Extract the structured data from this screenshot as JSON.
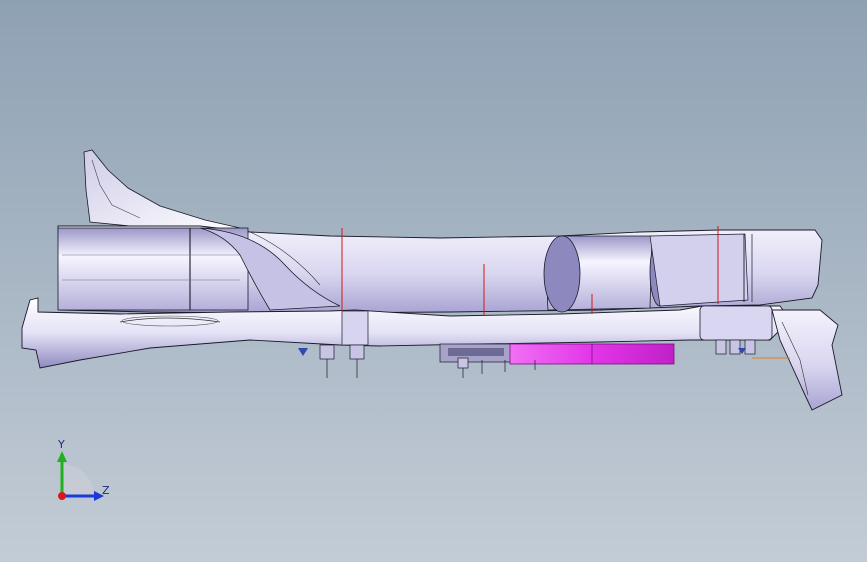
{
  "viewport": {
    "background_top": "#8ea1b3",
    "background_bottom": "#c3ccd6"
  },
  "model": {
    "body_color": "#e6e4f6",
    "shade_color": "#b9b5dc",
    "edge_color": "#1a1a2a",
    "highlight_color": "#e040e8",
    "dimension_line_color": "#d01818"
  },
  "triad": {
    "y_label": "Y",
    "z_label": "Z",
    "y_color": "#20b020",
    "z_color": "#1a3ad8",
    "x_color": "#d81818"
  }
}
